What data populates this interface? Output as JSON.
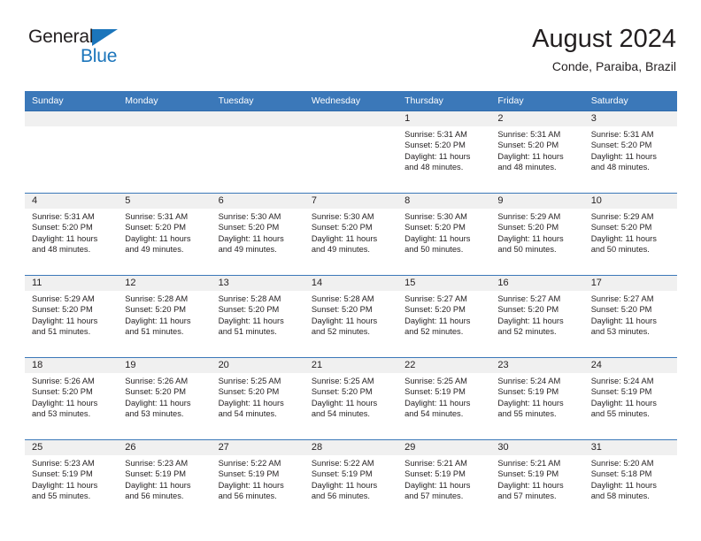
{
  "brand": {
    "word_one": "General",
    "word_two": "Blue",
    "triangle_color": "#1b75bb",
    "text_color": "#231f20"
  },
  "header": {
    "title": "August 2024",
    "subtitle": "Conde, Paraiba, Brazil"
  },
  "theme": {
    "header_blue": "#3b78b9",
    "daynum_band": "#f0f0f0",
    "text": "#231f20",
    "page_background": "#ffffff"
  },
  "weekdays": [
    "Sunday",
    "Monday",
    "Tuesday",
    "Wednesday",
    "Thursday",
    "Friday",
    "Saturday"
  ],
  "weeks": [
    [
      {
        "day": "",
        "l1": "",
        "l2": "",
        "l3": "",
        "l4": ""
      },
      {
        "day": "",
        "l1": "",
        "l2": "",
        "l3": "",
        "l4": ""
      },
      {
        "day": "",
        "l1": "",
        "l2": "",
        "l3": "",
        "l4": ""
      },
      {
        "day": "",
        "l1": "",
        "l2": "",
        "l3": "",
        "l4": ""
      },
      {
        "day": "1",
        "l1": "Sunrise: 5:31 AM",
        "l2": "Sunset: 5:20 PM",
        "l3": "Daylight: 11 hours",
        "l4": "and 48 minutes."
      },
      {
        "day": "2",
        "l1": "Sunrise: 5:31 AM",
        "l2": "Sunset: 5:20 PM",
        "l3": "Daylight: 11 hours",
        "l4": "and 48 minutes."
      },
      {
        "day": "3",
        "l1": "Sunrise: 5:31 AM",
        "l2": "Sunset: 5:20 PM",
        "l3": "Daylight: 11 hours",
        "l4": "and 48 minutes."
      }
    ],
    [
      {
        "day": "4",
        "l1": "Sunrise: 5:31 AM",
        "l2": "Sunset: 5:20 PM",
        "l3": "Daylight: 11 hours",
        "l4": "and 48 minutes."
      },
      {
        "day": "5",
        "l1": "Sunrise: 5:31 AM",
        "l2": "Sunset: 5:20 PM",
        "l3": "Daylight: 11 hours",
        "l4": "and 49 minutes."
      },
      {
        "day": "6",
        "l1": "Sunrise: 5:30 AM",
        "l2": "Sunset: 5:20 PM",
        "l3": "Daylight: 11 hours",
        "l4": "and 49 minutes."
      },
      {
        "day": "7",
        "l1": "Sunrise: 5:30 AM",
        "l2": "Sunset: 5:20 PM",
        "l3": "Daylight: 11 hours",
        "l4": "and 49 minutes."
      },
      {
        "day": "8",
        "l1": "Sunrise: 5:30 AM",
        "l2": "Sunset: 5:20 PM",
        "l3": "Daylight: 11 hours",
        "l4": "and 50 minutes."
      },
      {
        "day": "9",
        "l1": "Sunrise: 5:29 AM",
        "l2": "Sunset: 5:20 PM",
        "l3": "Daylight: 11 hours",
        "l4": "and 50 minutes."
      },
      {
        "day": "10",
        "l1": "Sunrise: 5:29 AM",
        "l2": "Sunset: 5:20 PM",
        "l3": "Daylight: 11 hours",
        "l4": "and 50 minutes."
      }
    ],
    [
      {
        "day": "11",
        "l1": "Sunrise: 5:29 AM",
        "l2": "Sunset: 5:20 PM",
        "l3": "Daylight: 11 hours",
        "l4": "and 51 minutes."
      },
      {
        "day": "12",
        "l1": "Sunrise: 5:28 AM",
        "l2": "Sunset: 5:20 PM",
        "l3": "Daylight: 11 hours",
        "l4": "and 51 minutes."
      },
      {
        "day": "13",
        "l1": "Sunrise: 5:28 AM",
        "l2": "Sunset: 5:20 PM",
        "l3": "Daylight: 11 hours",
        "l4": "and 51 minutes."
      },
      {
        "day": "14",
        "l1": "Sunrise: 5:28 AM",
        "l2": "Sunset: 5:20 PM",
        "l3": "Daylight: 11 hours",
        "l4": "and 52 minutes."
      },
      {
        "day": "15",
        "l1": "Sunrise: 5:27 AM",
        "l2": "Sunset: 5:20 PM",
        "l3": "Daylight: 11 hours",
        "l4": "and 52 minutes."
      },
      {
        "day": "16",
        "l1": "Sunrise: 5:27 AM",
        "l2": "Sunset: 5:20 PM",
        "l3": "Daylight: 11 hours",
        "l4": "and 52 minutes."
      },
      {
        "day": "17",
        "l1": "Sunrise: 5:27 AM",
        "l2": "Sunset: 5:20 PM",
        "l3": "Daylight: 11 hours",
        "l4": "and 53 minutes."
      }
    ],
    [
      {
        "day": "18",
        "l1": "Sunrise: 5:26 AM",
        "l2": "Sunset: 5:20 PM",
        "l3": "Daylight: 11 hours",
        "l4": "and 53 minutes."
      },
      {
        "day": "19",
        "l1": "Sunrise: 5:26 AM",
        "l2": "Sunset: 5:20 PM",
        "l3": "Daylight: 11 hours",
        "l4": "and 53 minutes."
      },
      {
        "day": "20",
        "l1": "Sunrise: 5:25 AM",
        "l2": "Sunset: 5:20 PM",
        "l3": "Daylight: 11 hours",
        "l4": "and 54 minutes."
      },
      {
        "day": "21",
        "l1": "Sunrise: 5:25 AM",
        "l2": "Sunset: 5:20 PM",
        "l3": "Daylight: 11 hours",
        "l4": "and 54 minutes."
      },
      {
        "day": "22",
        "l1": "Sunrise: 5:25 AM",
        "l2": "Sunset: 5:19 PM",
        "l3": "Daylight: 11 hours",
        "l4": "and 54 minutes."
      },
      {
        "day": "23",
        "l1": "Sunrise: 5:24 AM",
        "l2": "Sunset: 5:19 PM",
        "l3": "Daylight: 11 hours",
        "l4": "and 55 minutes."
      },
      {
        "day": "24",
        "l1": "Sunrise: 5:24 AM",
        "l2": "Sunset: 5:19 PM",
        "l3": "Daylight: 11 hours",
        "l4": "and 55 minutes."
      }
    ],
    [
      {
        "day": "25",
        "l1": "Sunrise: 5:23 AM",
        "l2": "Sunset: 5:19 PM",
        "l3": "Daylight: 11 hours",
        "l4": "and 55 minutes."
      },
      {
        "day": "26",
        "l1": "Sunrise: 5:23 AM",
        "l2": "Sunset: 5:19 PM",
        "l3": "Daylight: 11 hours",
        "l4": "and 56 minutes."
      },
      {
        "day": "27",
        "l1": "Sunrise: 5:22 AM",
        "l2": "Sunset: 5:19 PM",
        "l3": "Daylight: 11 hours",
        "l4": "and 56 minutes."
      },
      {
        "day": "28",
        "l1": "Sunrise: 5:22 AM",
        "l2": "Sunset: 5:19 PM",
        "l3": "Daylight: 11 hours",
        "l4": "and 56 minutes."
      },
      {
        "day": "29",
        "l1": "Sunrise: 5:21 AM",
        "l2": "Sunset: 5:19 PM",
        "l3": "Daylight: 11 hours",
        "l4": "and 57 minutes."
      },
      {
        "day": "30",
        "l1": "Sunrise: 5:21 AM",
        "l2": "Sunset: 5:19 PM",
        "l3": "Daylight: 11 hours",
        "l4": "and 57 minutes."
      },
      {
        "day": "31",
        "l1": "Sunrise: 5:20 AM",
        "l2": "Sunset: 5:18 PM",
        "l3": "Daylight: 11 hours",
        "l4": "and 58 minutes."
      }
    ]
  ]
}
